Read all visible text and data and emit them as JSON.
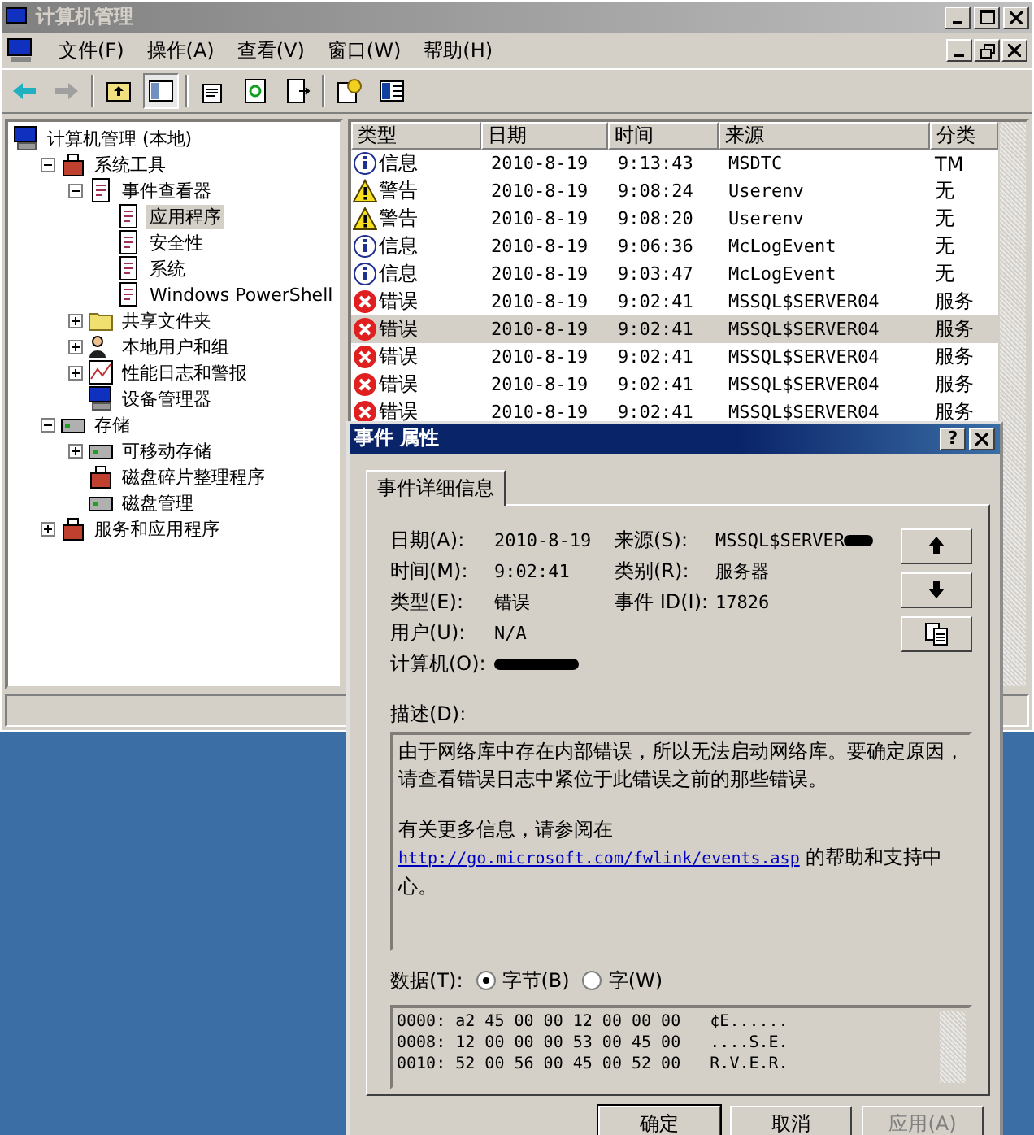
{
  "window": {
    "title": "计算机管理"
  },
  "menu": [
    "文件(F)",
    "操作(A)",
    "查看(V)",
    "窗口(W)",
    "帮助(H)"
  ],
  "tree": [
    {
      "label": "计算机管理 (本地)",
      "kind": "computer",
      "selected": false,
      "children": [
        {
          "label": "系统工具",
          "kind": "tools",
          "selected": false,
          "expanded": true,
          "children": [
            {
              "label": "事件查看器",
              "kind": "log",
              "selected": false,
              "expanded": true,
              "children": [
                {
                  "label": "应用程序",
                  "kind": "log",
                  "selected": true
                },
                {
                  "label": "安全性",
                  "kind": "log",
                  "selected": false
                },
                {
                  "label": "系统",
                  "kind": "log",
                  "selected": false
                },
                {
                  "label": "Windows PowerShell",
                  "kind": "log",
                  "selected": false
                }
              ]
            },
            {
              "label": "共享文件夹",
              "kind": "folder",
              "selected": false,
              "expanded": false
            },
            {
              "label": "本地用户和组",
              "kind": "users",
              "selected": false,
              "expanded": false
            },
            {
              "label": "性能日志和警报",
              "kind": "chart",
              "selected": false,
              "expanded": false
            },
            {
              "label": "设备管理器",
              "kind": "computer",
              "selected": false
            }
          ]
        },
        {
          "label": "存储",
          "kind": "disk",
          "selected": false,
          "expanded": true,
          "children": [
            {
              "label": "可移动存储",
              "kind": "disk",
              "selected": false,
              "expanded": false
            },
            {
              "label": "磁盘碎片整理程序",
              "kind": "tools",
              "selected": false
            },
            {
              "label": "磁盘管理",
              "kind": "disk",
              "selected": false
            }
          ]
        },
        {
          "label": "服务和应用程序",
          "kind": "tools",
          "selected": false,
          "expanded": false
        }
      ]
    }
  ],
  "table": {
    "columns": [
      "类型",
      "日期",
      "时间",
      "来源",
      "分类"
    ],
    "rows": [
      {
        "kind": "info",
        "type": "信息",
        "date": "2010-8-19",
        "time": "9:13:43",
        "source": "MSDTC",
        "category": "TM",
        "selected": false
      },
      {
        "kind": "warning",
        "type": "警告",
        "date": "2010-8-19",
        "time": "9:08:24",
        "source": "Userenv",
        "category": "无",
        "selected": false
      },
      {
        "kind": "warning",
        "type": "警告",
        "date": "2010-8-19",
        "time": "9:08:20",
        "source": "Userenv",
        "category": "无",
        "selected": false
      },
      {
        "kind": "info",
        "type": "信息",
        "date": "2010-8-19",
        "time": "9:06:36",
        "source": "McLogEvent",
        "category": "无",
        "selected": false
      },
      {
        "kind": "info",
        "type": "信息",
        "date": "2010-8-19",
        "time": "9:03:47",
        "source": "McLogEvent",
        "category": "无",
        "selected": false
      },
      {
        "kind": "error",
        "type": "错误",
        "date": "2010-8-19",
        "time": "9:02:41",
        "source": "MSSQL$SERVER04",
        "category": "服务",
        "selected": false
      },
      {
        "kind": "error",
        "type": "错误",
        "date": "2010-8-19",
        "time": "9:02:41",
        "source": "MSSQL$SERVER04",
        "category": "服务",
        "selected": true
      },
      {
        "kind": "error",
        "type": "错误",
        "date": "2010-8-19",
        "time": "9:02:41",
        "source": "MSSQL$SERVER04",
        "category": "服务",
        "selected": false
      },
      {
        "kind": "error",
        "type": "错误",
        "date": "2010-8-19",
        "time": "9:02:41",
        "source": "MSSQL$SERVER04",
        "category": "服务",
        "selected": false
      },
      {
        "kind": "error",
        "type": "错误",
        "date": "2010-8-19",
        "time": "9:02:41",
        "source": "MSSQL$SERVER04",
        "category": "服务",
        "selected": false
      }
    ]
  },
  "dialog": {
    "title": "事件 属性",
    "help_button": "?",
    "tabs": [
      {
        "label": "事件详细信息",
        "selected": true
      }
    ],
    "fields": [
      [
        {
          "label": "日期(A):",
          "value": "2010-8-19"
        },
        {
          "label": "来源(S):",
          "value": "MSSQL$SERVER"
        }
      ],
      [
        {
          "label": "时间(M):",
          "value": "9:02:41"
        },
        {
          "label": "类别(R):",
          "value": "服务器"
        }
      ],
      [
        {
          "label": "类型(E):",
          "value": "错误"
        },
        {
          "label": "事件 ID(I):",
          "value": "17826"
        }
      ],
      [
        {
          "label": "用户(U):",
          "value": "N/A"
        }
      ],
      [
        {
          "label": "计算机(O):"
        }
      ]
    ],
    "description_label": "描述(D):",
    "description": [
      "由于网络库中存在内部错误，所以无法启动网络库。要确定原因，请查看错误日志中紧位于此错误之前的那些错误。"
    ],
    "more_info": {
      "before": "有关更多信息，请参阅在",
      "link": "http://go.microsoft.com/fwlink/events.asp",
      "after": " 的帮助和支持中心。"
    },
    "data_label": "数据(T):",
    "radios": [
      {
        "label": "字节(B)",
        "selected": true
      },
      {
        "label": "字(W)",
        "selected": false
      }
    ],
    "hex_lines": [
      "0000: a2 45 00 00 12 00 00 00   ¢E......",
      "0008: 12 00 00 00 53 00 45 00   ....S.E.",
      "0010: 52 00 56 00 45 00 52 00   R.V.E.R."
    ],
    "buttons": [
      {
        "label": "确定",
        "disabled": false
      },
      {
        "label": "取消",
        "disabled": false
      },
      {
        "label": "应用(A)",
        "disabled": true
      }
    ]
  }
}
